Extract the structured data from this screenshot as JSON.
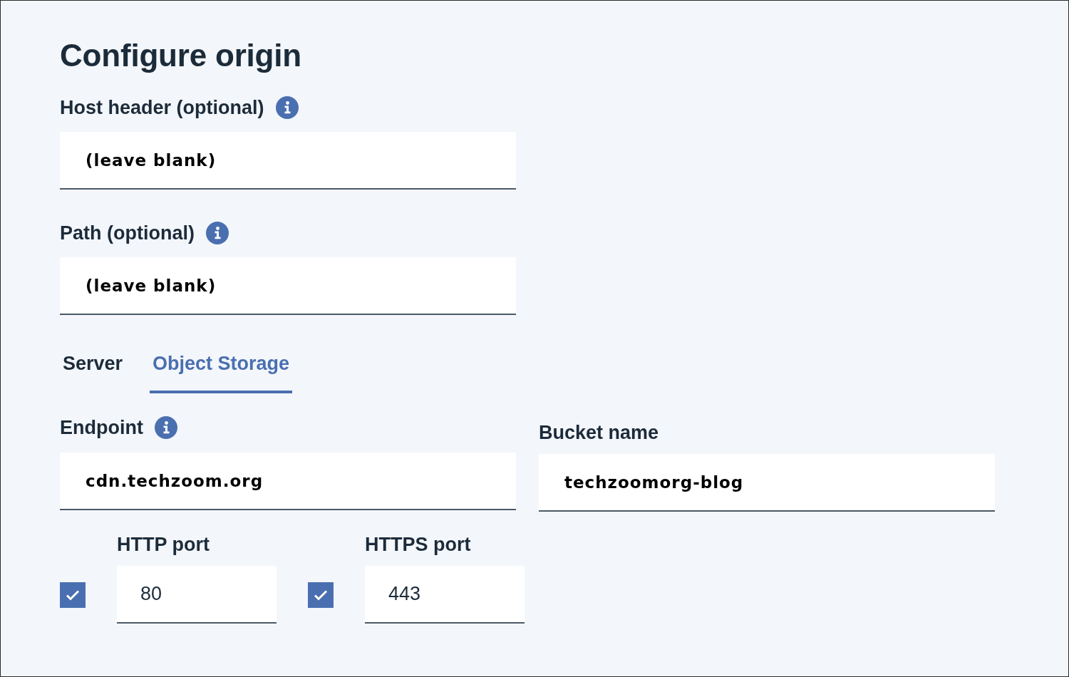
{
  "title": "Configure origin",
  "fields": [
    {
      "label": "Host header (optional)",
      "info": true,
      "value": "(leave blank)"
    },
    {
      "label": "Path (optional)",
      "info": true,
      "value": "(leave blank)"
    }
  ],
  "tabs": [
    {
      "label": "Server",
      "selected": false
    },
    {
      "label": "Object Storage",
      "selected": true
    }
  ],
  "endpoint": {
    "label": "Endpoint",
    "info": true,
    "value": "cdn.techzoom.org"
  },
  "bucket": {
    "label": "Bucket name",
    "value": "techzoomorg-blog"
  },
  "ports": [
    {
      "label": "HTTP port",
      "checked": true,
      "value": "80"
    },
    {
      "label": "HTTPS port",
      "checked": true,
      "value": "443"
    }
  ]
}
